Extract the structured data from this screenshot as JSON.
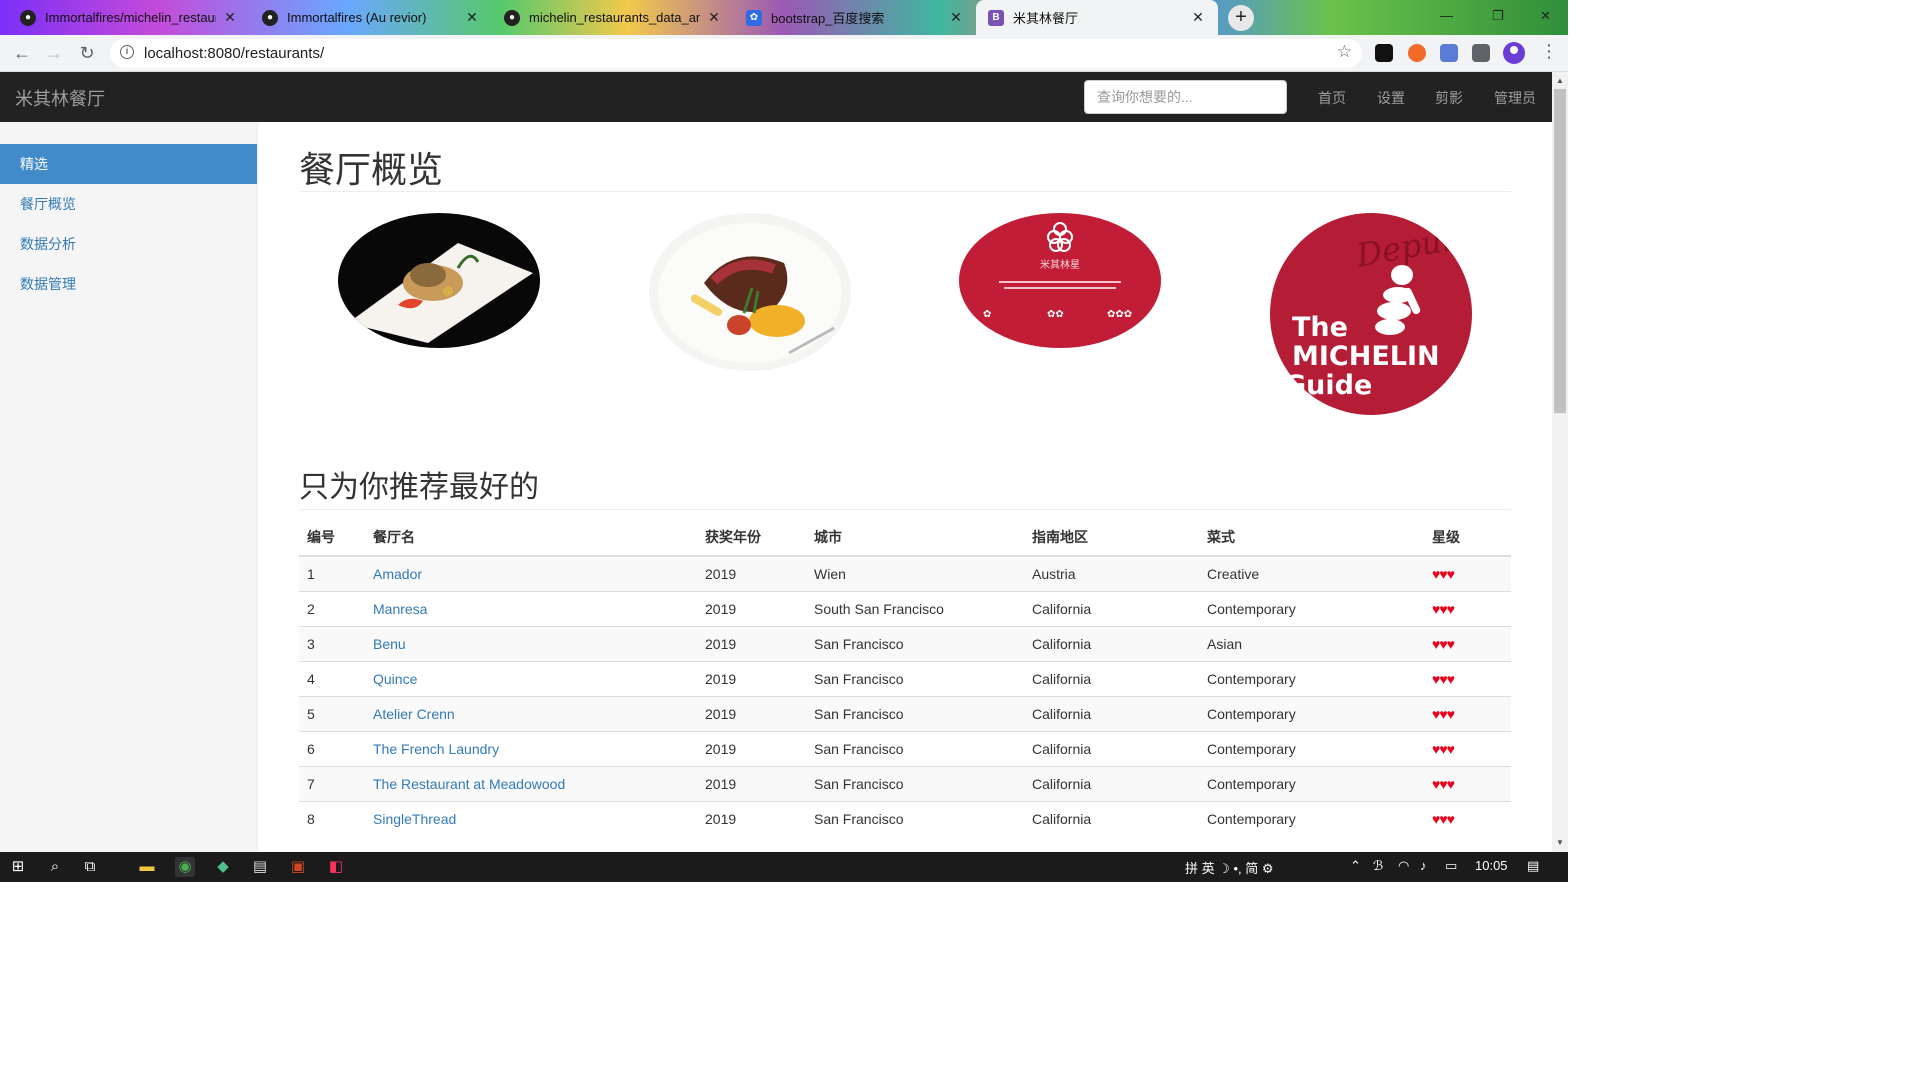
{
  "browser": {
    "tabs": [
      {
        "title": "Immortalfires/michelin_restaur",
        "favicon": "github-icon",
        "active": false
      },
      {
        "title": "Immortalfires (Au revior)",
        "favicon": "github-icon",
        "active": false
      },
      {
        "title": "michelin_restaurants_data_an",
        "favicon": "github-icon",
        "active": false
      },
      {
        "title": "bootstrap_百度搜索",
        "favicon": "baidu-icon",
        "active": false
      },
      {
        "title": "米其林餐厅",
        "favicon": "bootstrap-icon",
        "active": true
      }
    ],
    "url": "localhost:8080/restaurants/"
  },
  "navbar": {
    "brand": "米其林餐厅",
    "search_placeholder": "查询你想要的...",
    "links": [
      "首页",
      "设置",
      "剪影",
      "管理员"
    ]
  },
  "sidebar": {
    "items": [
      {
        "label": "精选",
        "active": true
      },
      {
        "label": "餐厅概览",
        "active": false
      },
      {
        "label": "数据分析",
        "active": false
      },
      {
        "label": "数据管理",
        "active": false
      }
    ]
  },
  "main": {
    "heading": "餐厅概览",
    "images": [
      {
        "name": "food-photo-dessert"
      },
      {
        "name": "food-photo-steak"
      },
      {
        "name": "michelin-star-card",
        "caption": "米其林星"
      },
      {
        "name": "michelin-guide-logo",
        "text_lines": [
          "The",
          "MICHELIN",
          "Guide"
        ],
        "script": "Depuis"
      }
    ],
    "recommend_heading": "只为你推荐最好的",
    "table": {
      "columns": [
        "编号",
        "餐厅名",
        "获奖年份",
        "城市",
        "指南地区",
        "菜式",
        "星级"
      ],
      "rows": [
        {
          "id": "1",
          "name": "Amador",
          "year": "2019",
          "city": "Wien",
          "region": "Austria",
          "cuisine": "Creative",
          "stars": "♥♥♥"
        },
        {
          "id": "2",
          "name": "Manresa",
          "year": "2019",
          "city": "South San Francisco",
          "region": "California",
          "cuisine": "Contemporary",
          "stars": "♥♥♥"
        },
        {
          "id": "3",
          "name": "Benu",
          "year": "2019",
          "city": "San Francisco",
          "region": "California",
          "cuisine": "Asian",
          "stars": "♥♥♥"
        },
        {
          "id": "4",
          "name": "Quince",
          "year": "2019",
          "city": "San Francisco",
          "region": "California",
          "cuisine": "Contemporary",
          "stars": "♥♥♥"
        },
        {
          "id": "5",
          "name": "Atelier Crenn",
          "year": "2019",
          "city": "San Francisco",
          "region": "California",
          "cuisine": "Contemporary",
          "stars": "♥♥♥"
        },
        {
          "id": "6",
          "name": "The French Laundry",
          "year": "2019",
          "city": "San Francisco",
          "region": "California",
          "cuisine": "Contemporary",
          "stars": "♥♥♥"
        },
        {
          "id": "7",
          "name": "The Restaurant at Meadowood",
          "year": "2019",
          "city": "San Francisco",
          "region": "California",
          "cuisine": "Contemporary",
          "stars": "♥♥♥"
        },
        {
          "id": "8",
          "name": "SingleThread",
          "year": "2019",
          "city": "San Francisco",
          "region": "California",
          "cuisine": "Contemporary",
          "stars": "♥♥♥"
        }
      ]
    }
  },
  "taskbar": {
    "ime": "拼 英 ☽ •, 简 ⚙",
    "time": "10:05"
  },
  "colors": {
    "navbar_bg": "#222222",
    "sidebar_active": "#428bca",
    "link": "#337ab7",
    "heart": "#e8001c",
    "michelin_red": "#b51c35"
  }
}
